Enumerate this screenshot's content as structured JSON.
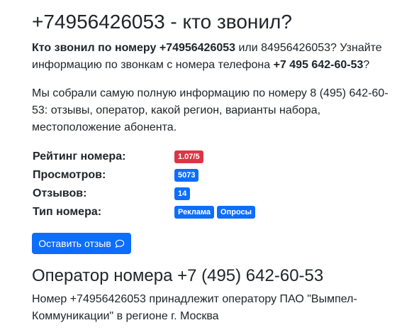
{
  "page_title": "+74956426053 - кто звонил?",
  "intro": {
    "bold1": "Кто звонил по номеру +74956426053",
    "text1": " или 84956426053? Узнайте информацию по звонкам с номера телефона ",
    "bold2": "+7 495 642-60-53",
    "text2": "?"
  },
  "collected_text": "Мы собрали самую полную информацию по номеру 8 (495) 642-60-53: отзывы, оператор, какой регион, варианты набора, местоположение абонента.",
  "stats": {
    "rating_label": "Рейтинг номера:",
    "rating_value": "1.07/5",
    "views_label": "Просмотров:",
    "views_value": "5073",
    "reviews_label": "Отзывов:",
    "reviews_value": "14",
    "type_label": "Тип номера:",
    "type_tags": [
      "Реклама",
      "Опросы"
    ]
  },
  "colors": {
    "danger": "#dc3545",
    "primary": "#0d6efd"
  },
  "button": {
    "label": "Оставить отзыв",
    "icon": "chat-bubble-icon"
  },
  "operator": {
    "heading": "Оператор номера +7 (495) 642-60-53",
    "text": "Номер +74956426053 принадлежит оператору ПАО \"Вымпел-Коммуникации\" в регионе г. Москва"
  }
}
